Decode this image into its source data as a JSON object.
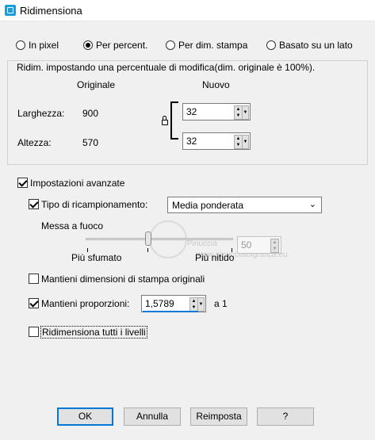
{
  "window": {
    "title": "Ridimensiona",
    "icon": "resize-app-icon"
  },
  "modes": [
    {
      "label": "In pixel",
      "selected": false
    },
    {
      "label": "Per percent.",
      "selected": true
    },
    {
      "label": "Per dim. stampa",
      "selected": false
    },
    {
      "label": "Basato su un lato",
      "selected": false
    }
  ],
  "group": {
    "title": "Ridim. impostando una percentuale di modifica(dim. originale è 100%).",
    "col_original": "Originale",
    "col_new": "Nuovo",
    "width_label": "Larghezza:",
    "width_original": "900",
    "width_new": "32",
    "height_label": "Altezza:",
    "height_original": "570",
    "height_new": "32"
  },
  "advanced": {
    "label": "Impostazioni avanzate",
    "checked": true,
    "resample_label": "Tipo di ricampionamento:",
    "resample_checked": true,
    "resample_value": "Media ponderata",
    "sharpen_label": "Messa a fuoco",
    "sharpen_min_label": "Più sfumato",
    "sharpen_max_label": "Più nitido",
    "sharpen_value": "50",
    "keep_print_label": "Mantieni dimensioni di stampa originali",
    "keep_print_checked": false,
    "keep_ratio_label": "Mantieni proporzioni:",
    "keep_ratio_checked": true,
    "ratio_value": "1,5789",
    "ratio_suffix": "a 1",
    "all_layers_label": "Ridimensiona tutti i livelli",
    "all_layers_checked": false
  },
  "buttons": {
    "ok": "OK",
    "cancel": "Annulla",
    "reset": "Reimposta",
    "help": "?"
  },
  "watermark": {
    "line1": "Pinuccia",
    "line2": "www.pinuccialdigrafica.eu"
  }
}
